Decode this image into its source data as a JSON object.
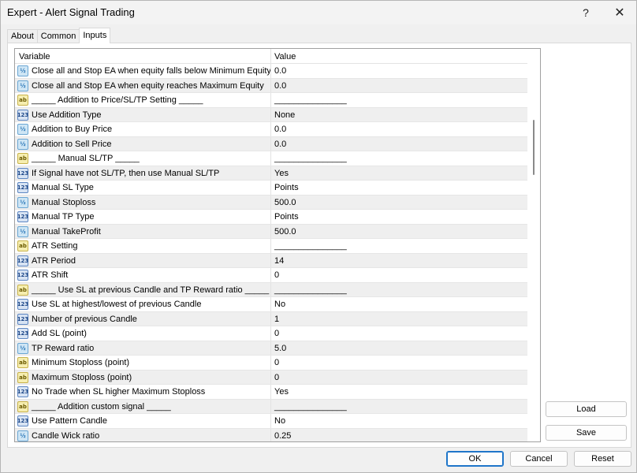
{
  "window": {
    "title": "Expert - Alert Signal Trading",
    "help_label": "?",
    "close_label": "✕"
  },
  "tabs": [
    {
      "label": "About"
    },
    {
      "label": "Common"
    },
    {
      "label": "Inputs",
      "active": true
    }
  ],
  "grid": {
    "col_variable": "Variable",
    "col_value": "Value",
    "rows": [
      {
        "icon": "double",
        "icon_text": "½",
        "variable": "Close all and Stop EA when equity falls below Minimum Equity",
        "value": "0.0"
      },
      {
        "icon": "double",
        "icon_text": "½",
        "variable": "Close all and Stop EA when equity reaches Maximum Equity",
        "value": "0.0"
      },
      {
        "icon": "string",
        "icon_text": "ab",
        "variable": "_____ Addition to Price/SL/TP Setting _____",
        "value": "_______________"
      },
      {
        "icon": "int",
        "icon_text": "123",
        "variable": "Use Addition Type",
        "value": "None"
      },
      {
        "icon": "double",
        "icon_text": "½",
        "variable": "Addition to Buy Price",
        "value": "0.0"
      },
      {
        "icon": "double",
        "icon_text": "½",
        "variable": "Addition to Sell Price",
        "value": "0.0"
      },
      {
        "icon": "string",
        "icon_text": "ab",
        "variable": "_____ Manual SL/TP _____",
        "value": "_______________"
      },
      {
        "icon": "int",
        "icon_text": "123",
        "variable": "If Signal have not SL/TP, then use Manual SL/TP",
        "value": "Yes"
      },
      {
        "icon": "int",
        "icon_text": "123",
        "variable": "Manual SL Type",
        "value": "Points"
      },
      {
        "icon": "double",
        "icon_text": "½",
        "variable": "Manual Stoploss",
        "value": "500.0"
      },
      {
        "icon": "int",
        "icon_text": "123",
        "variable": "Manual TP Type",
        "value": "Points"
      },
      {
        "icon": "double",
        "icon_text": "½",
        "variable": "Manual TakeProfit",
        "value": "500.0"
      },
      {
        "icon": "string",
        "icon_text": "ab",
        "variable": "ATR Setting",
        "value": "_______________"
      },
      {
        "icon": "int",
        "icon_text": "123",
        "variable": "ATR Period",
        "value": "14"
      },
      {
        "icon": "int",
        "icon_text": "123",
        "variable": "ATR Shift",
        "value": "0"
      },
      {
        "icon": "string",
        "icon_text": "ab",
        "variable": "_____ Use SL at previous Candle and TP Reward ratio _____",
        "value": "_______________"
      },
      {
        "icon": "int",
        "icon_text": "123",
        "variable": "Use SL at highest/lowest of previous Candle",
        "value": "No"
      },
      {
        "icon": "int",
        "icon_text": "123",
        "variable": "Number of previous Candle",
        "value": "1"
      },
      {
        "icon": "int",
        "icon_text": "123",
        "variable": "Add SL (point)",
        "value": "0"
      },
      {
        "icon": "double",
        "icon_text": "½",
        "variable": "TP Reward ratio",
        "value": "5.0"
      },
      {
        "icon": "string",
        "icon_text": "ab",
        "variable": "Minimum Stoploss (point)",
        "value": "0"
      },
      {
        "icon": "string",
        "icon_text": "ab",
        "variable": "Maximum Stoploss (point)",
        "value": "0"
      },
      {
        "icon": "int",
        "icon_text": "123",
        "variable": "No Trade when SL higher Maximum Stoploss",
        "value": "Yes"
      },
      {
        "icon": "string",
        "icon_text": "ab",
        "variable": "_____ Addition custom signal _____",
        "value": "_______________"
      },
      {
        "icon": "int",
        "icon_text": "123",
        "variable": "Use Pattern Candle",
        "value": "No"
      },
      {
        "icon": "double",
        "icon_text": "½",
        "variable": "Candle Wick ratio",
        "value": "0.25"
      }
    ]
  },
  "buttons": {
    "load": "Load",
    "save": "Save",
    "ok": "OK",
    "cancel": "Cancel",
    "reset": "Reset"
  }
}
